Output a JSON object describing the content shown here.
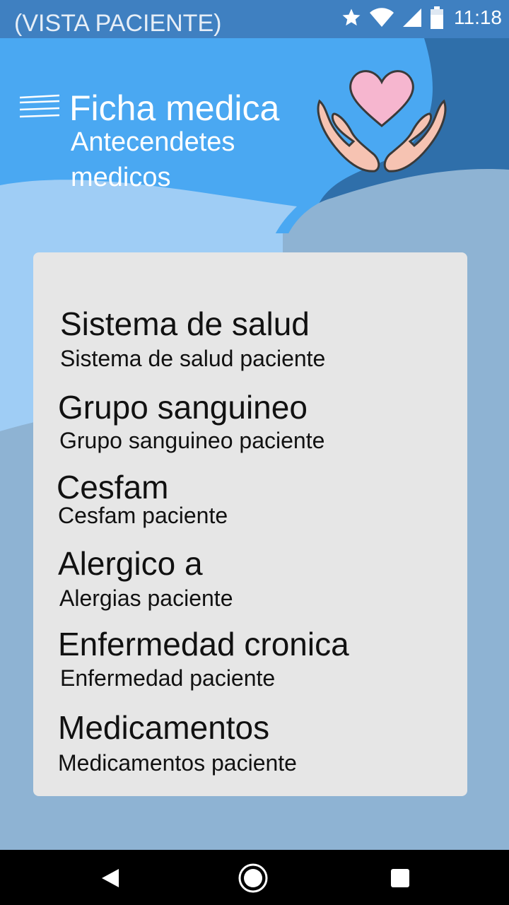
{
  "status_bar": {
    "title": "(VISTA PACIENTE)",
    "time": "11:18",
    "icons": [
      "star-icon",
      "wifi-icon",
      "signal-icon",
      "battery-icon"
    ]
  },
  "header": {
    "title": "Ficha medica",
    "subtitle": "Antecendetes medicos",
    "menu_icon": "hamburger-menu-icon",
    "logo": "heart-hands-logo"
  },
  "fields": [
    {
      "label": "Sistema de salud",
      "value": "Sistema de  salud paciente"
    },
    {
      "label": "Grupo  sanguineo",
      "value": "Grupo sanguineo paciente"
    },
    {
      "label": "Cesfam",
      "value": "Cesfam paciente"
    },
    {
      "label": "Alergico a",
      "value": "Alergias paciente"
    },
    {
      "label": "Enfermedad cronica",
      "value": "Enfermedad paciente"
    },
    {
      "label": "Medicamentos",
      "value": "Medicamentos paciente"
    }
  ],
  "nav_bar": {
    "buttons": [
      "back-icon",
      "home-icon",
      "recents-icon"
    ]
  },
  "colors": {
    "status_bar": "#3f80c1",
    "header_light": "#4aa8f2",
    "header_dark": "#2f6faa",
    "page_bg": "#8eb3d3",
    "card_bg": "#e6e6e6",
    "heart": "#f6b6cf",
    "hands": "#f6c3b2"
  }
}
